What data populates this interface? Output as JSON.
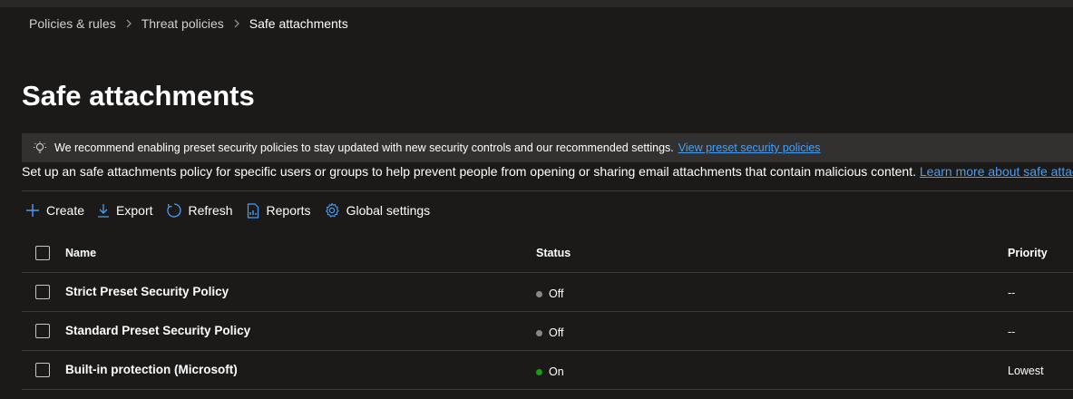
{
  "breadcrumb": {
    "items": [
      "Policies & rules",
      "Threat policies",
      "Safe attachments"
    ]
  },
  "page": {
    "title": "Safe attachments"
  },
  "banner": {
    "text": "We recommend enabling preset security policies to stay updated with new security controls and our recommended settings.",
    "link": "View preset security policies",
    "icon": "lightbulb-icon"
  },
  "description": {
    "text": "Set up an safe attachments policy for specific users or groups to help prevent people from opening or sharing email attachments that contain malicious content.",
    "link": "Learn more about safe attac"
  },
  "toolbar": {
    "create": "Create",
    "export": "Export",
    "refresh": "Refresh",
    "reports": "Reports",
    "global_settings": "Global settings"
  },
  "table": {
    "columns": {
      "name": "Name",
      "status": "Status",
      "priority": "Priority"
    },
    "rows": [
      {
        "name": "Strict Preset Security Policy",
        "status": "Off",
        "priority": "--"
      },
      {
        "name": "Standard Preset Security Policy",
        "status": "Off",
        "priority": "--"
      },
      {
        "name": "Built-in protection (Microsoft)",
        "status": "On",
        "priority": "Lowest"
      }
    ]
  },
  "colors": {
    "background": "#1b1a19",
    "link": "#479ef5",
    "accent": "#479ef5",
    "status_off": "#8a8886",
    "status_on": "#13a10e"
  }
}
